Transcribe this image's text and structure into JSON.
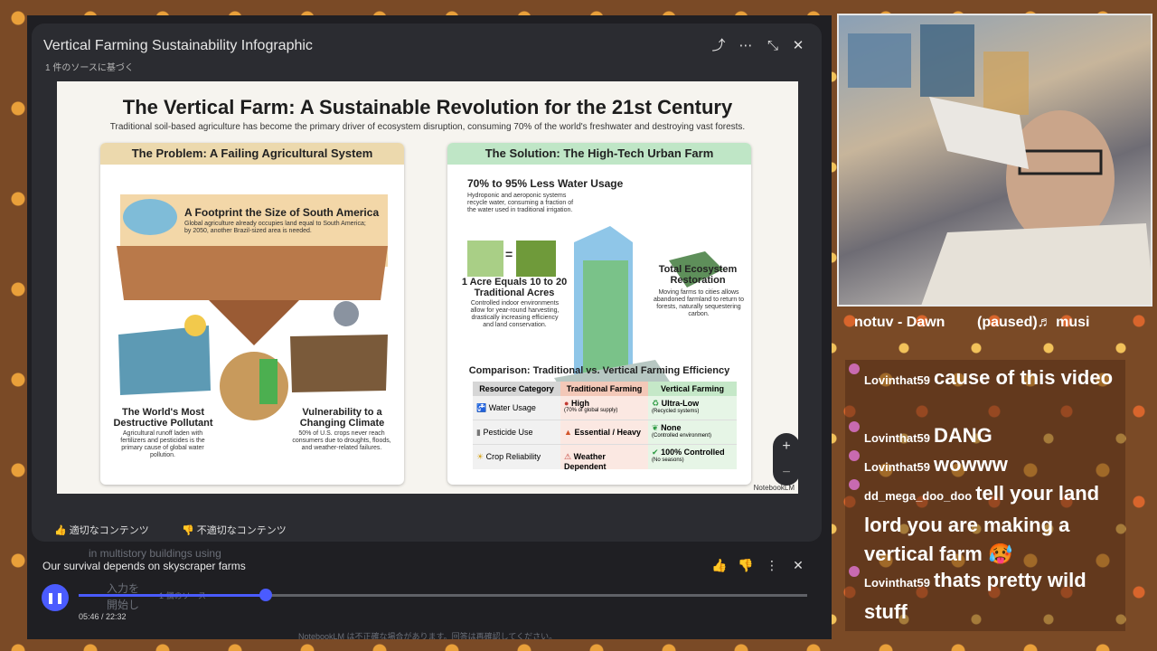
{
  "window": {
    "title": "Vertical Farming Sustainability Infographic",
    "subtitle": "1 件のソースに基づく",
    "icons": [
      "share-icon",
      "more-icon",
      "collapse-icon",
      "close-icon"
    ]
  },
  "slide": {
    "title": "The Vertical Farm: A Sustainable Revolution for the 21st Century",
    "subtitle": "Traditional soil-based agriculture has become the primary driver of ecosystem disruption, consuming 70% of the world's freshwater and destroying vast forests.",
    "problem": {
      "header": "The Problem: A Failing Agricultural System",
      "footprint_title": "A Footprint the Size of South America",
      "footprint_body": "Global agriculture already occupies land equal to South America; by 2050, another Brazil-sized area is needed.",
      "pollutant_title": "The World's Most Destructive Pollutant",
      "pollutant_body": "Agricultural runoff laden with fertilizers and pesticides is the primary cause of global water pollution.",
      "climate_title": "Vulnerability to a Changing Climate",
      "climate_body": "50% of U.S. crops never reach consumers due to droughts, floods, and weather-related failures."
    },
    "solution": {
      "header": "The Solution: The High-Tech Urban Farm",
      "water_title": "70% to 95% Less Water Usage",
      "water_body": "Hydroponic and aeroponic systems recycle water, consuming a fraction of the water used in traditional irrigation.",
      "acre_title": "1 Acre Equals 10 to 20 Traditional Acres",
      "acre_body": "Controlled indoor environments allow for year-round harvesting, drastically increasing efficiency and land conservation.",
      "eco_title": "Total Ecosystem Restoration",
      "eco_body": "Moving farms to cities allows abandoned farmland to return to forests, naturally sequestering carbon.",
      "comparison_title": "Comparison: Traditional vs. Vertical Farming Efficiency",
      "table_headers": [
        "Resource Category",
        "Traditional Farming",
        "Vertical Farming"
      ],
      "rows": [
        {
          "category": "Water Usage",
          "trad": "High",
          "trad_note": "(70% of global supply)",
          "vert": "Ultra-Low",
          "vert_note": "(Recycled systems)"
        },
        {
          "category": "Pesticide Use",
          "trad": "Essential / Heavy",
          "trad_note": "",
          "vert": "None",
          "vert_note": "(Controlled environment)"
        },
        {
          "category": "Crop Reliability",
          "trad": "Weather Dependent",
          "trad_note": "",
          "vert": "100% Controlled",
          "vert_note": "(No seasons)"
        }
      ],
      "equals": "="
    },
    "watermark": "NotebookLM"
  },
  "feedback": {
    "good": "適切なコンテンツ",
    "bad": "不適切なコンテンツ"
  },
  "background_ghost": {
    "line1": "in multistory buildings using",
    "line2": "入力を",
    "line3": "開始し",
    "line4": "1 個のソース",
    "footer": "NotebookLM は不正確な場合があります。回答は再確認してください。"
  },
  "player": {
    "title": "Our survival depends on skyscraper farms",
    "current": "05:46",
    "total": "22:32",
    "progress_fraction": 0.257,
    "time_label": "05:46 / 22:32"
  },
  "zoom": {
    "plus": "+",
    "minus": "−"
  },
  "stream": {
    "now_playing": "notuv - Dawn        (paused)♬ musi",
    "chat": [
      {
        "user": "Lovinthat59",
        "text": "cause of this video"
      },
      {
        "user": "Lovinthat59",
        "text": "DANG"
      },
      {
        "user": "Lovinthat59",
        "text": "wowww"
      },
      {
        "user": "dd_mega_doo_doo",
        "text": "tell your land lord you are making a vertical farm 🥵"
      },
      {
        "user": "Lovinthat59",
        "text": "thats pretty wild stuff"
      }
    ]
  },
  "colors": {
    "accent": "#4a5bff",
    "problem_header": "#ecd9ad",
    "solution_header": "#bfe6c6"
  }
}
